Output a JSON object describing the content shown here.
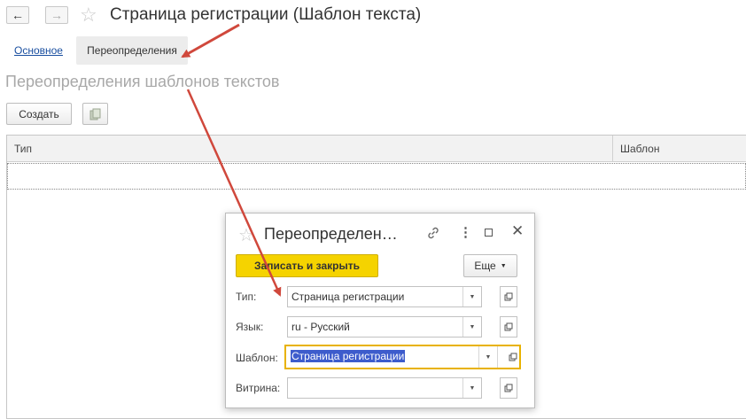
{
  "window": {
    "title": "Страница регистрации (Шаблон текста)",
    "tabs": {
      "main": "Основное",
      "overrides": "Переопределения"
    }
  },
  "section": {
    "title": "Переопределения шаблонов текстов",
    "create_label": "Создать"
  },
  "table": {
    "columns": [
      "Тип",
      "Шаблон"
    ],
    "rows": []
  },
  "dialog": {
    "title": "Переопределен…",
    "save_close_label": "Записать и закрыть",
    "more_label": "Еще",
    "fields": [
      {
        "label": "Тип:",
        "value": "Страница регистрации"
      },
      {
        "label": "Язык:",
        "value": "ru - Русский"
      },
      {
        "label": "Шаблон:",
        "value": "Страница регистрации"
      },
      {
        "label": "Витрина:",
        "value": ""
      }
    ]
  },
  "colors": {
    "accent_yellow": "#f5d300",
    "focus_border": "#e8b200",
    "selection": "#3d5ccc",
    "annotation_arrow": "#d0483c",
    "link": "#1a4fa0"
  },
  "icons": [
    "back-arrow-icon",
    "forward-arrow-icon",
    "star-icon",
    "copy-icon",
    "link-icon",
    "more-vertical-icon",
    "maximize-icon",
    "close-icon",
    "dropdown-icon",
    "open-icon"
  ]
}
